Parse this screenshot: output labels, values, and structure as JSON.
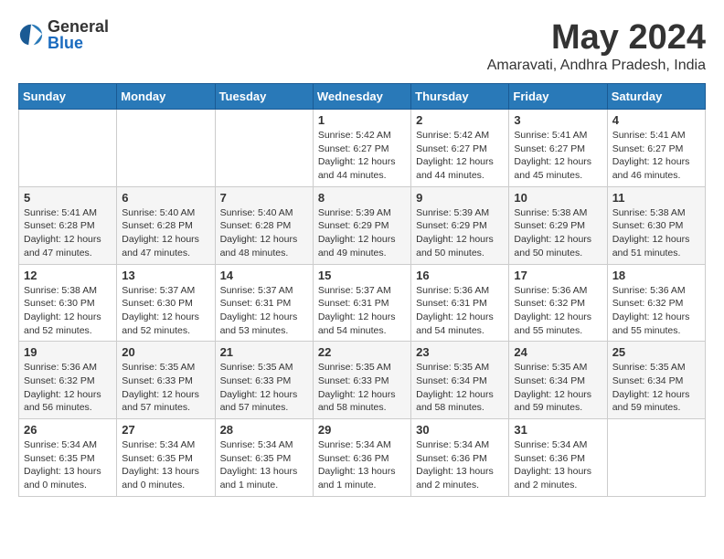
{
  "logo": {
    "general": "General",
    "blue": "Blue"
  },
  "title": "May 2024",
  "subtitle": "Amaravati, Andhra Pradesh, India",
  "days_of_week": [
    "Sunday",
    "Monday",
    "Tuesday",
    "Wednesday",
    "Thursday",
    "Friday",
    "Saturday"
  ],
  "weeks": [
    [
      {
        "day": "",
        "info": ""
      },
      {
        "day": "",
        "info": ""
      },
      {
        "day": "",
        "info": ""
      },
      {
        "day": "1",
        "info": "Sunrise: 5:42 AM\nSunset: 6:27 PM\nDaylight: 12 hours\nand 44 minutes."
      },
      {
        "day": "2",
        "info": "Sunrise: 5:42 AM\nSunset: 6:27 PM\nDaylight: 12 hours\nand 44 minutes."
      },
      {
        "day": "3",
        "info": "Sunrise: 5:41 AM\nSunset: 6:27 PM\nDaylight: 12 hours\nand 45 minutes."
      },
      {
        "day": "4",
        "info": "Sunrise: 5:41 AM\nSunset: 6:27 PM\nDaylight: 12 hours\nand 46 minutes."
      }
    ],
    [
      {
        "day": "5",
        "info": "Sunrise: 5:41 AM\nSunset: 6:28 PM\nDaylight: 12 hours\nand 47 minutes."
      },
      {
        "day": "6",
        "info": "Sunrise: 5:40 AM\nSunset: 6:28 PM\nDaylight: 12 hours\nand 47 minutes."
      },
      {
        "day": "7",
        "info": "Sunrise: 5:40 AM\nSunset: 6:28 PM\nDaylight: 12 hours\nand 48 minutes."
      },
      {
        "day": "8",
        "info": "Sunrise: 5:39 AM\nSunset: 6:29 PM\nDaylight: 12 hours\nand 49 minutes."
      },
      {
        "day": "9",
        "info": "Sunrise: 5:39 AM\nSunset: 6:29 PM\nDaylight: 12 hours\nand 50 minutes."
      },
      {
        "day": "10",
        "info": "Sunrise: 5:38 AM\nSunset: 6:29 PM\nDaylight: 12 hours\nand 50 minutes."
      },
      {
        "day": "11",
        "info": "Sunrise: 5:38 AM\nSunset: 6:30 PM\nDaylight: 12 hours\nand 51 minutes."
      }
    ],
    [
      {
        "day": "12",
        "info": "Sunrise: 5:38 AM\nSunset: 6:30 PM\nDaylight: 12 hours\nand 52 minutes."
      },
      {
        "day": "13",
        "info": "Sunrise: 5:37 AM\nSunset: 6:30 PM\nDaylight: 12 hours\nand 52 minutes."
      },
      {
        "day": "14",
        "info": "Sunrise: 5:37 AM\nSunset: 6:31 PM\nDaylight: 12 hours\nand 53 minutes."
      },
      {
        "day": "15",
        "info": "Sunrise: 5:37 AM\nSunset: 6:31 PM\nDaylight: 12 hours\nand 54 minutes."
      },
      {
        "day": "16",
        "info": "Sunrise: 5:36 AM\nSunset: 6:31 PM\nDaylight: 12 hours\nand 54 minutes."
      },
      {
        "day": "17",
        "info": "Sunrise: 5:36 AM\nSunset: 6:32 PM\nDaylight: 12 hours\nand 55 minutes."
      },
      {
        "day": "18",
        "info": "Sunrise: 5:36 AM\nSunset: 6:32 PM\nDaylight: 12 hours\nand 55 minutes."
      }
    ],
    [
      {
        "day": "19",
        "info": "Sunrise: 5:36 AM\nSunset: 6:32 PM\nDaylight: 12 hours\nand 56 minutes."
      },
      {
        "day": "20",
        "info": "Sunrise: 5:35 AM\nSunset: 6:33 PM\nDaylight: 12 hours\nand 57 minutes."
      },
      {
        "day": "21",
        "info": "Sunrise: 5:35 AM\nSunset: 6:33 PM\nDaylight: 12 hours\nand 57 minutes."
      },
      {
        "day": "22",
        "info": "Sunrise: 5:35 AM\nSunset: 6:33 PM\nDaylight: 12 hours\nand 58 minutes."
      },
      {
        "day": "23",
        "info": "Sunrise: 5:35 AM\nSunset: 6:34 PM\nDaylight: 12 hours\nand 58 minutes."
      },
      {
        "day": "24",
        "info": "Sunrise: 5:35 AM\nSunset: 6:34 PM\nDaylight: 12 hours\nand 59 minutes."
      },
      {
        "day": "25",
        "info": "Sunrise: 5:35 AM\nSunset: 6:34 PM\nDaylight: 12 hours\nand 59 minutes."
      }
    ],
    [
      {
        "day": "26",
        "info": "Sunrise: 5:34 AM\nSunset: 6:35 PM\nDaylight: 13 hours\nand 0 minutes."
      },
      {
        "day": "27",
        "info": "Sunrise: 5:34 AM\nSunset: 6:35 PM\nDaylight: 13 hours\nand 0 minutes."
      },
      {
        "day": "28",
        "info": "Sunrise: 5:34 AM\nSunset: 6:35 PM\nDaylight: 13 hours\nand 1 minute."
      },
      {
        "day": "29",
        "info": "Sunrise: 5:34 AM\nSunset: 6:36 PM\nDaylight: 13 hours\nand 1 minute."
      },
      {
        "day": "30",
        "info": "Sunrise: 5:34 AM\nSunset: 6:36 PM\nDaylight: 13 hours\nand 2 minutes."
      },
      {
        "day": "31",
        "info": "Sunrise: 5:34 AM\nSunset: 6:36 PM\nDaylight: 13 hours\nand 2 minutes."
      },
      {
        "day": "",
        "info": ""
      }
    ]
  ]
}
